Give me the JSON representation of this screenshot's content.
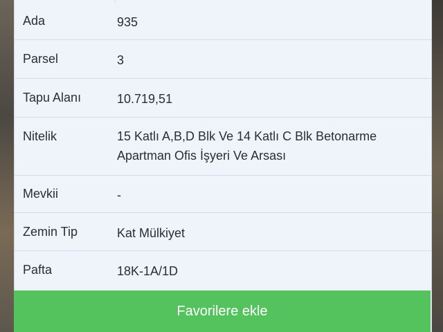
{
  "rows": [
    {
      "label": "Ada",
      "value": "935"
    },
    {
      "label": "Parsel",
      "value": "3"
    },
    {
      "label": "Tapu Alanı",
      "value": "10.719,51"
    },
    {
      "label": "Nitelik",
      "value": "15 Katlı A,B,D Blk Ve 14 Katlı C Blk Betonarme Apartman Ofis İşyeri Ve Arsası"
    },
    {
      "label": "Mevkii",
      "value": "-"
    },
    {
      "label": "Zemin Tip",
      "value": "Kat Mülkiyet"
    },
    {
      "label": "Pafta",
      "value": "18K-1A/1D"
    }
  ],
  "button": {
    "label": "Favorilere ekle"
  },
  "colors": {
    "button_bg": "#54c35e",
    "panel_bg": "#eef4fa"
  }
}
